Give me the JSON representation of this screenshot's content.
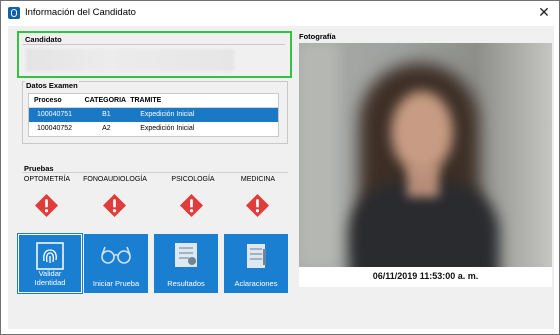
{
  "window": {
    "title": "Información del Candidato",
    "close_glyph": "✕"
  },
  "candidato": {
    "label": "Candidato",
    "name": ""
  },
  "datos_examen": {
    "label": "Datos Examen",
    "columns": [
      "Proceso",
      "CATEGORIA",
      "TRAMITE"
    ],
    "rows": [
      {
        "proceso": "100040751",
        "categoria": "B1",
        "tramite": "Expedición Inicial",
        "selected": true
      },
      {
        "proceso": "100040752",
        "categoria": "A2",
        "tramite": "Expedición Inicial",
        "selected": false
      }
    ]
  },
  "pruebas": {
    "label": "Pruebas",
    "items": [
      {
        "name": "OPTOMETRÍA",
        "status_icon": "warning-diamond-icon"
      },
      {
        "name": "FONOAUDIOLOGÍA",
        "status_icon": "warning-diamond-icon"
      },
      {
        "name": "PSICOLOGÍA",
        "status_icon": "warning-diamond-icon"
      },
      {
        "name": "MEDICINA",
        "status_icon": "warning-diamond-icon"
      }
    ]
  },
  "actions": {
    "validar": {
      "line1": "Validar",
      "line2": "Identidad",
      "icon": "fingerprint-icon"
    },
    "iniciar": {
      "label": "Iniciar Prueba",
      "icon": "glasses-icon"
    },
    "resultados": {
      "label": "Resultados",
      "icon": "results-document-icon"
    },
    "aclaraciones": {
      "label": "Aclaraciones",
      "icon": "notes-icon"
    }
  },
  "fotografia": {
    "label": "Fotografía",
    "timestamp": "06/11/2019 11:53:00 a. m."
  },
  "colors": {
    "accent": "#1a7fd0",
    "selection": "#1a79c4",
    "warning": "#e03c3c",
    "highlight_border": "#33c33f"
  }
}
